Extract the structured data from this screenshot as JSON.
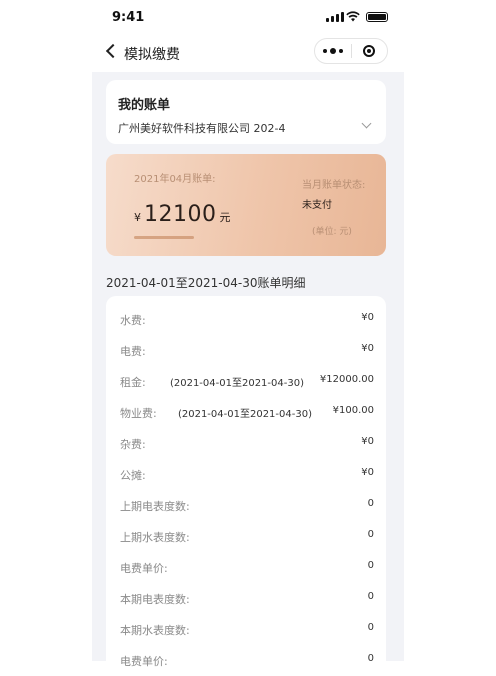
{
  "status_bar": {
    "time": "9:41"
  },
  "nav": {
    "title": "模拟缴费"
  },
  "account": {
    "title": "我的账单",
    "name": "广州美好软件科技有限公司 202-4"
  },
  "bill": {
    "month_label": "2021年04月账单:",
    "currency": "¥",
    "amount": "12100",
    "unit": "元",
    "status_label": "当月账单状态:",
    "status": "未支付",
    "unit_note": "(单位: 元)"
  },
  "detail_title": "2021-04-01至2021-04-30账单明细",
  "details": [
    {
      "label": "水费:",
      "period": "",
      "value": "¥0"
    },
    {
      "label": "电费:",
      "period": "",
      "value": "¥0"
    },
    {
      "label": "租金:",
      "period": "(2021-04-01至2021-04-30)",
      "value": "¥12000.00"
    },
    {
      "label": "物业费:",
      "period": "(2021-04-01至2021-04-30)",
      "value": "¥100.00"
    },
    {
      "label": "杂费:",
      "period": "",
      "value": "¥0"
    },
    {
      "label": "公摊:",
      "period": "",
      "value": "¥0"
    },
    {
      "label": "上期电表度数:",
      "period": "",
      "value": "0"
    },
    {
      "label": "上期水表度数:",
      "period": "",
      "value": "0"
    },
    {
      "label": "电费单价:",
      "period": "",
      "value": "0"
    },
    {
      "label": "本期电表度数:",
      "period": "",
      "value": "0"
    },
    {
      "label": "本期水表度数:",
      "period": "",
      "value": "0"
    },
    {
      "label": "电费单价:",
      "period": "",
      "value": "0"
    }
  ]
}
